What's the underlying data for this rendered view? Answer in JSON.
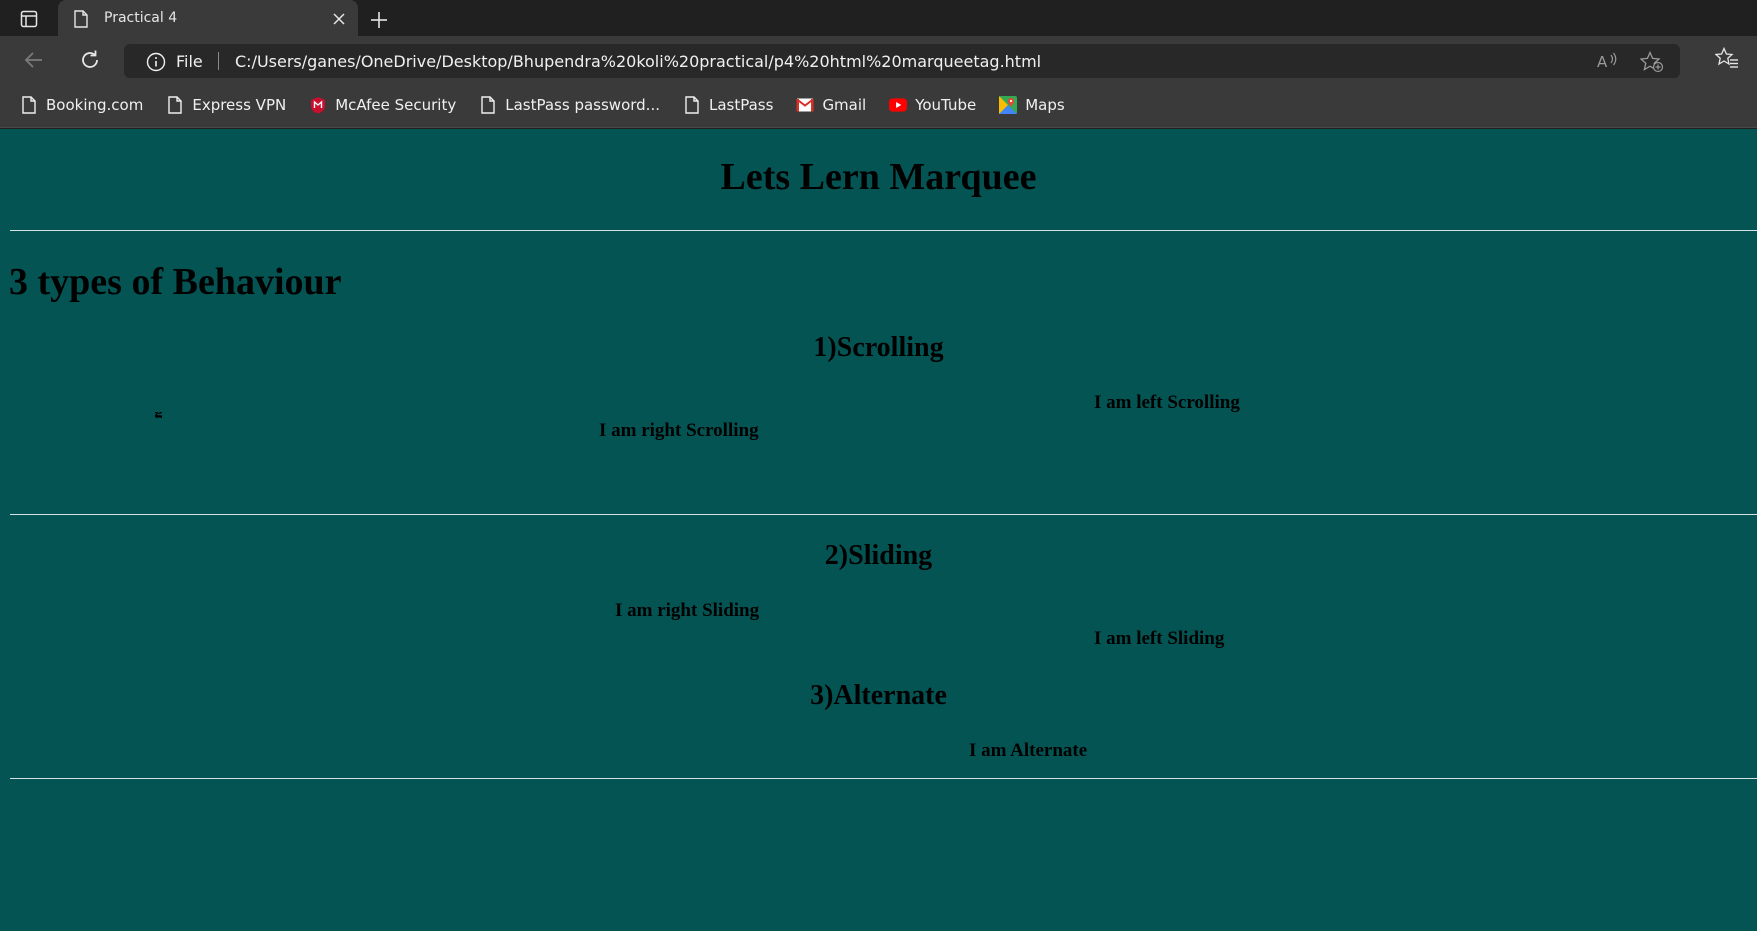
{
  "browser": {
    "tab": {
      "title": "Practical 4"
    },
    "address": {
      "scheme_label": "File",
      "url": "C:/Users/ganes/OneDrive/Desktop/Bhupendra%20koli%20practical/p4%20html%20marqueetag.html"
    },
    "bookmarks": [
      {
        "label": "Booking.com",
        "icon": "page-icon"
      },
      {
        "label": "Express VPN",
        "icon": "page-icon"
      },
      {
        "label": "McAfee Security",
        "icon": "mcafee-icon"
      },
      {
        "label": "LastPass password...",
        "icon": "page-icon"
      },
      {
        "label": "LastPass",
        "icon": "page-icon"
      },
      {
        "label": "Gmail",
        "icon": "gmail-icon"
      },
      {
        "label": "YouTube",
        "icon": "youtube-icon"
      },
      {
        "label": "Maps",
        "icon": "maps-icon"
      }
    ],
    "colors": {
      "page_background": "#045454",
      "chrome_dark": "#202020",
      "chrome_mid": "#3a3a3a"
    }
  },
  "page": {
    "title": "Lets Lern Marquee",
    "subtitle": "3 types of Behaviour",
    "scrolling": {
      "heading": "1)Scrolling",
      "left_text": "I am left Scrolling",
      "right_text": "I am right Scrolling"
    },
    "sliding": {
      "heading": "2)Sliding",
      "right_text": "I am right Sliding",
      "left_text": "I am left Sliding"
    },
    "alternate": {
      "heading": "3)Alternate",
      "text": "I am Alternate"
    }
  }
}
